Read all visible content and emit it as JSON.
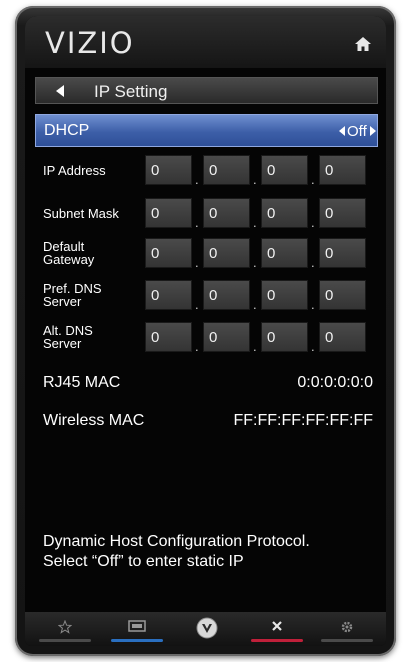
{
  "header": {
    "logo": "VIZIO",
    "home_icon": "home-icon"
  },
  "title_bar": {
    "back_icon": "left-triangle-icon",
    "title": "IP Setting"
  },
  "dhcp": {
    "label": "DHCP",
    "value": "Off",
    "highlight_color": "#3d5fa8"
  },
  "fields": [
    {
      "label": "IP Address",
      "octets": [
        "0",
        "0",
        "0",
        "0"
      ]
    },
    {
      "label": "Subnet Mask",
      "octets": [
        "0",
        "0",
        "0",
        "0"
      ]
    },
    {
      "label": "Default Gateway",
      "octets": [
        "0",
        "0",
        "0",
        "0"
      ]
    },
    {
      "label": "Pref. DNS Server",
      "octets": [
        "0",
        "0",
        "0",
        "0"
      ]
    },
    {
      "label": "Alt. DNS Server",
      "octets": [
        "0",
        "0",
        "0",
        "0"
      ]
    }
  ],
  "separator": ".",
  "mac": {
    "rj45_label": "RJ45 MAC",
    "rj45_value": "0:0:0:0:0:0",
    "wireless_label": "Wireless MAC",
    "wireless_value": "FF:FF:FF:FF:FF:FF"
  },
  "help": {
    "line1": "Dynamic Host Configuration Protocol.",
    "line2": "Select “Off” to enter static IP"
  },
  "bottom_nav": [
    {
      "icon": "star-icon",
      "accent": "#4a4a4a"
    },
    {
      "icon": "input-icon",
      "accent": "#2a6fc0"
    },
    {
      "icon": "vizio-v-icon",
      "accent": "#4a4a4a"
    },
    {
      "icon": "close-icon",
      "accent": "#c0203a"
    },
    {
      "icon": "gear-icon",
      "accent": "#4a4a4a"
    }
  ]
}
